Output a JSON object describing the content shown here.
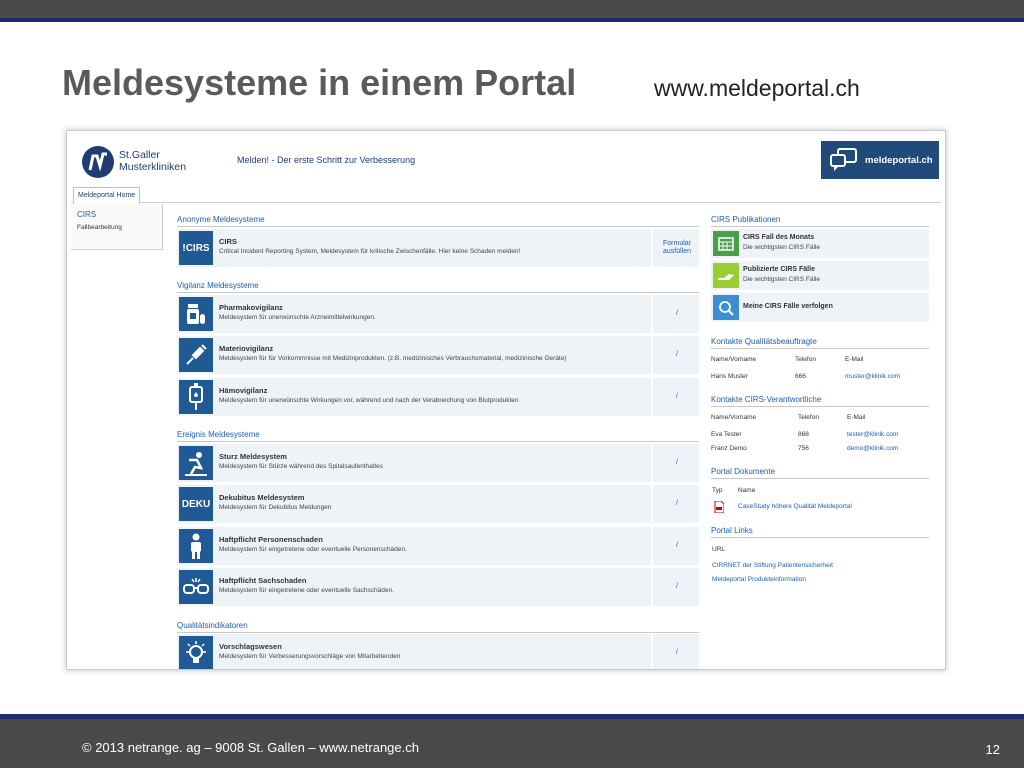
{
  "slide": {
    "title": "Meldesysteme in einem Portal",
    "url": "www.meldeportal.ch",
    "footer": "© 2013 netrange. ag – 9008 St. Gallen – www.netrange.ch",
    "page_number": "12"
  },
  "portal": {
    "brand_line1": "St.Galler",
    "brand_line2": "Musterkliniken",
    "tagline": "Melden! - Der erste Schritt zur Verbesserung",
    "logo_text": "meldeportal.ch",
    "tab": "Meldeportal Home",
    "leftnav": {
      "title": "CIRS",
      "sub": "Fallbearbeitung"
    },
    "sections": {
      "anonym": "Anonyme Meldesysteme",
      "vigilanz": "Vigilanz Meldesysteme",
      "ereignis": "Ereignis Meldesysteme",
      "qualitaet": "Qualitätsindikatoren"
    },
    "rows": [
      {
        "icon": "!CIRS",
        "title": "CIRS",
        "desc": "Critical Incident Reporting System, Meldesystem für kritische Zwischenfälle. Hier keine Schaden melden!",
        "action": "Formular ausfüllen"
      },
      {
        "icon": "",
        "title": "Pharmakovigilanz",
        "desc": "Meldesystem für unerwünschte Arzneimittelwirkungen.",
        "action": "/"
      },
      {
        "icon": "",
        "title": "Materiovigilanz",
        "desc": "Meldesystem für für Vorkommnisse mit Medizinprodukten. (z.B. medizinisches Verbrauchsmaterial, medizinische Geräte)",
        "action": "/"
      },
      {
        "icon": "",
        "title": "Hämovigilanz",
        "desc": "Meldesystem für unerwünschte Wirkungen vor, während und nach der Verabreichung von Blutprodukten",
        "action": "/"
      },
      {
        "icon": "",
        "title": "Sturz Meldesystem",
        "desc": "Meldesystem für Stürze während des Spitalsaufenthaltes",
        "action": "/"
      },
      {
        "icon": "DEKU",
        "title": "Dekubitus Meldesystem",
        "desc": "Meldesystem für Dekubitus Meldungen",
        "action": "/"
      },
      {
        "icon": "",
        "title": "Haftpflicht Personenschaden",
        "desc": "Meldesystem für eingetretene oder eventuelle Personenschäden.",
        "action": "/"
      },
      {
        "icon": "",
        "title": "Haftpflicht Sachschaden",
        "desc": "Meldesystem für eingetretene oder eventuelle Sachschäden.",
        "action": "/"
      },
      {
        "icon": "",
        "title": "Vorschlagswesen",
        "desc": "Meldesystem für Verbesserungsvorschläge von Mitarbeitenden",
        "action": "/"
      }
    ],
    "publikationen": {
      "title": "CIRS Publikationen",
      "items": [
        {
          "title": "CIRS Fall des Monats",
          "desc": "Die wichtigsten CIRS Fälle"
        },
        {
          "title": "Publizierte CIRS Fälle",
          "desc": "Die wichtigsten CIRS Fälle"
        },
        {
          "title": "Meine CIRS Fälle verfolgen",
          "desc": ""
        }
      ]
    },
    "qualitaet_contacts": {
      "title": "Kontakte Qualitätsbeauftragte",
      "headers": [
        "Name/Vorname",
        "Telefon",
        "E-Mail"
      ],
      "rows": [
        [
          "Hans Muster",
          "666",
          "muster@klinik.com"
        ]
      ]
    },
    "cirs_contacts": {
      "title": "Kontakte CIRS-Verantwortliche",
      "headers": [
        "Name/Vorname",
        "Telefon",
        "E-Mail"
      ],
      "rows": [
        [
          "Eva Tester",
          "868",
          "tester@klinik.com"
        ],
        [
          "Franz Demo",
          "756",
          "demo@klinik.com"
        ]
      ]
    },
    "dokumente": {
      "title": "Portal Dokumente",
      "headers": [
        "Typ",
        "Name"
      ],
      "item": "CaseStudy höhere Qualität Meldeportal"
    },
    "links": {
      "title": "Portal Links",
      "header": "URL",
      "items": [
        "CIRRNET der Stiftung Patientensicherheit",
        "Meldeportal Produkteinformation"
      ]
    }
  }
}
